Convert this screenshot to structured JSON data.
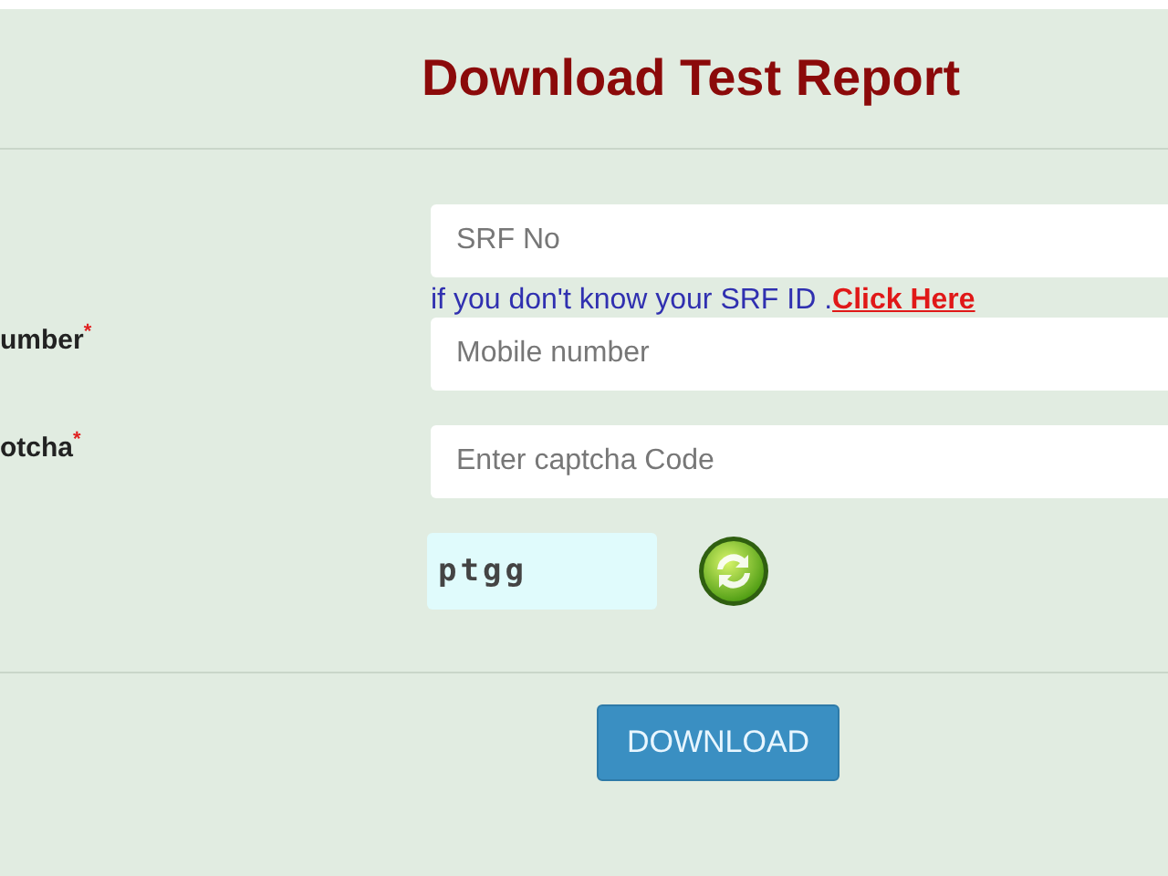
{
  "title": "Download Test Report",
  "fields": [
    {
      "placeholder": "SRF No",
      "help": {
        "text": "if you don't know your SRF ID .",
        "link": "Click Here"
      }
    },
    {
      "label": {
        "text": "umber",
        "mark": "*"
      },
      "placeholder": "Mobile number"
    },
    {
      "label": {
        "text": "otcha",
        "mark": "*"
      },
      "placeholder": "Enter captcha Code"
    }
  ],
  "captcha": {
    "code": "ptgg"
  },
  "button": "DOWNLOAD"
}
